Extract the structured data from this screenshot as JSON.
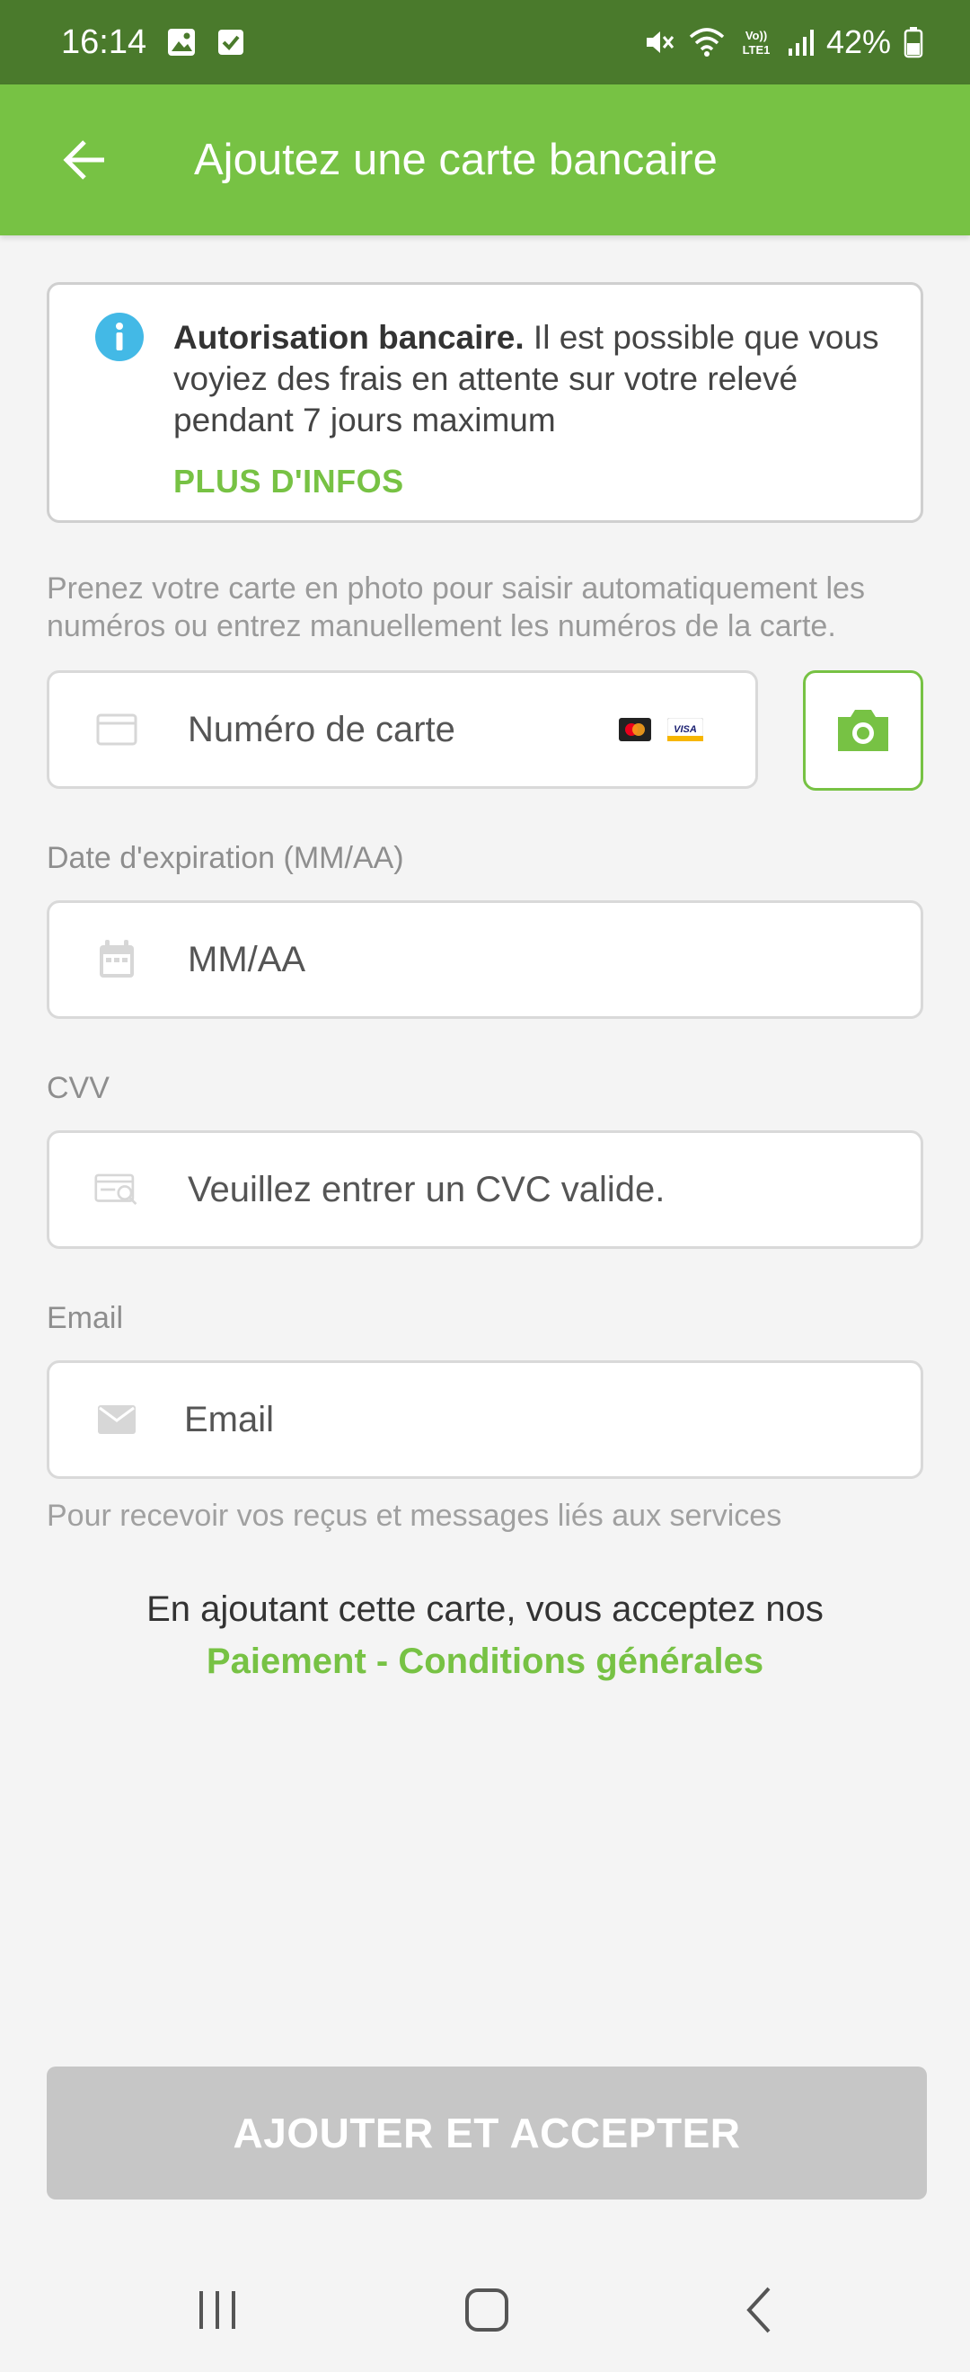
{
  "status_bar": {
    "time": "16:14",
    "battery": "42%"
  },
  "app_bar": {
    "title": "Ajoutez une carte bancaire"
  },
  "info_card": {
    "title": "Autorisation bancaire.",
    "body": " Il est possible que vous voyiez des frais en attente sur votre relevé pendant 7 jours maximum",
    "link": "PLUS D'INFOS"
  },
  "hint": "Prenez votre carte en photo pour saisir automatiquement les numéros ou entrez manuellement les numéros de la carte.",
  "card_number": {
    "placeholder": "Numéro de carte"
  },
  "expiry": {
    "label": "Date d'expiration (MM/AA)",
    "placeholder": "MM/AA"
  },
  "cvv": {
    "label": "CVV",
    "placeholder": "Veuillez entrer un CVC valide."
  },
  "email": {
    "label": "Email",
    "placeholder": "Email",
    "hint": "Pour recevoir vos reçus et messages liés aux services"
  },
  "terms": {
    "text": "En ajoutant cette carte, vous acceptez nos",
    "link": "Paiement - Conditions générales"
  },
  "submit": {
    "label": "AJOUTER ET ACCEPTER"
  },
  "colors": {
    "brand": "#77c244",
    "status_bar": "#4a7a2c",
    "info": "#43b9e6",
    "disabled": "#c6c6c6"
  }
}
